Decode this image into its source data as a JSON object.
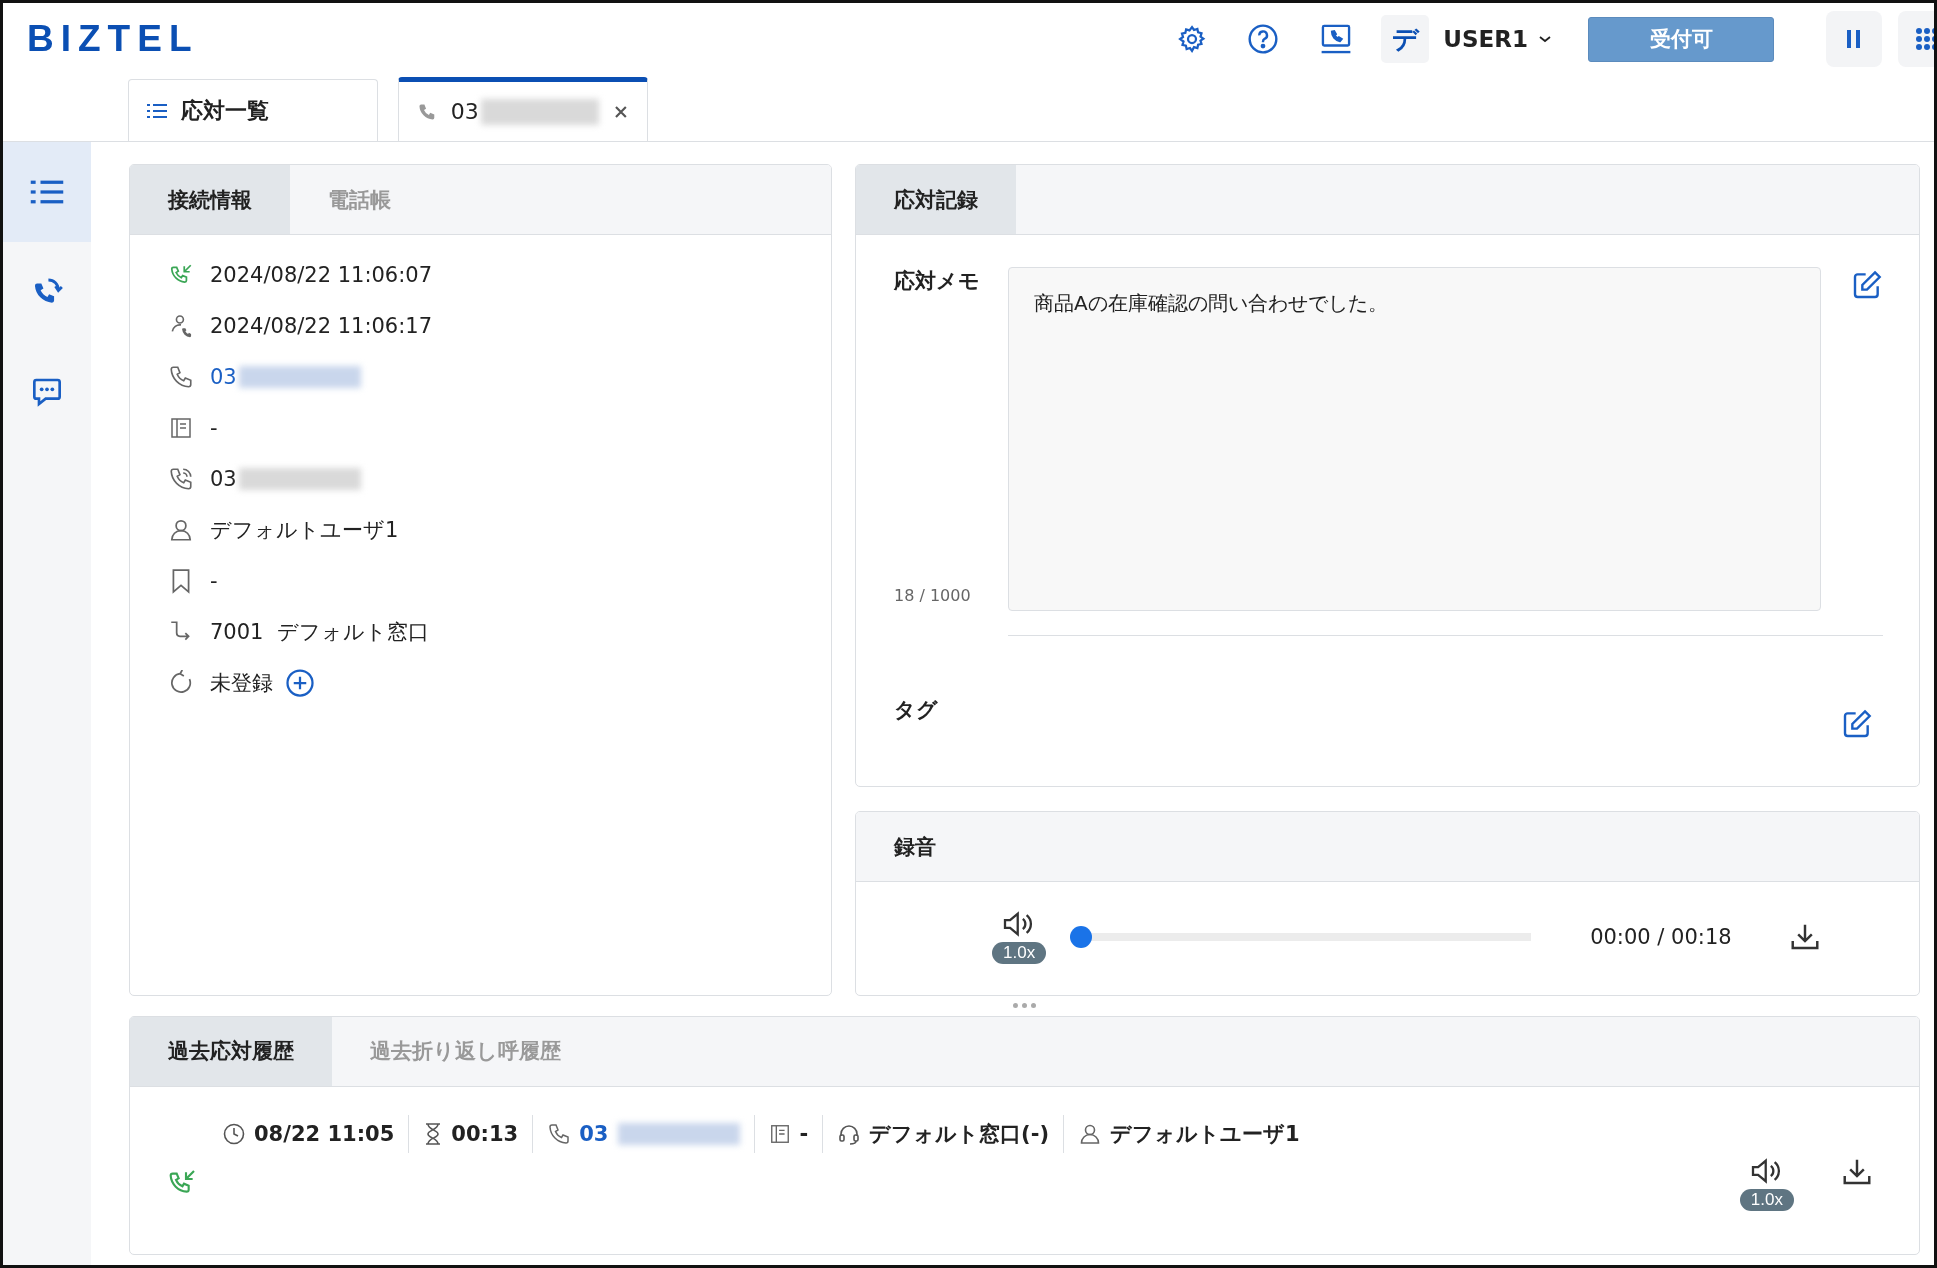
{
  "header": {
    "logo": "BIZTEL",
    "user_initial": "デ",
    "user_name": "USER1",
    "status_button": "受付可"
  },
  "sidebar": {
    "items": [
      {
        "kind": "list",
        "selected": true
      },
      {
        "kind": "callback",
        "selected": false
      },
      {
        "kind": "chat",
        "selected": false
      }
    ]
  },
  "tabs": [
    {
      "kind": "list",
      "label": "応対一覧",
      "redacted": false,
      "closable": false,
      "selected": false
    },
    {
      "kind": "phone",
      "label": "03",
      "redacted": true,
      "closable": true,
      "selected": true
    }
  ],
  "connection_panel": {
    "tabs": [
      {
        "label": "接続情報",
        "selected": true
      },
      {
        "label": "電話帳",
        "selected": false
      }
    ],
    "rows": [
      {
        "kind": "incoming",
        "text": "2024/08/22 11:06:07",
        "link": false,
        "redacted": false,
        "add_button": false
      },
      {
        "kind": "answered",
        "text": "2024/08/22 11:06:17",
        "link": false,
        "redacted": false,
        "add_button": false
      },
      {
        "kind": "phone",
        "text": "03",
        "link": true,
        "redacted": true,
        "add_button": false
      },
      {
        "kind": "note",
        "text": "-",
        "link": false,
        "redacted": false,
        "add_button": false
      },
      {
        "kind": "dialed",
        "text": "03",
        "link": false,
        "redacted": true,
        "add_button": false
      },
      {
        "kind": "user",
        "text": "デフォルトユーザ1",
        "link": false,
        "redacted": false,
        "add_button": false
      },
      {
        "kind": "bookmark",
        "text": "-",
        "link": false,
        "redacted": false,
        "add_button": false
      },
      {
        "kind": "route",
        "text": "7001  デフォルト窓口",
        "link": false,
        "redacted": false,
        "add_button": false
      },
      {
        "kind": "callback",
        "text": "未登録",
        "link": false,
        "redacted": false,
        "add_button": true
      }
    ]
  },
  "record_panel": {
    "tabs": [
      {
        "label": "応対記録",
        "selected": true
      }
    ],
    "memo_label": "応対メモ",
    "memo_value": "商品Aの在庫確認の問い合わせでした。",
    "char_count": "18 / 1000",
    "tag_label": "タグ"
  },
  "recording_panel": {
    "title": "録音",
    "speed": "1.0x",
    "level": 0,
    "time": "00:00 / 00:18"
  },
  "history_panel": {
    "tabs": [
      {
        "label": "過去応対履歴",
        "selected": true
      },
      {
        "label": "過去折り返し呼履歴",
        "selected": false
      }
    ],
    "entries": [
      {
        "time": "08/22 11:05",
        "duration": "00:13",
        "phone": "03",
        "redacted": true,
        "note": "-",
        "queue": "デフォルト窓口(-)",
        "user": "デフォルトユーザ1",
        "speed": "1.0x"
      }
    ]
  }
}
